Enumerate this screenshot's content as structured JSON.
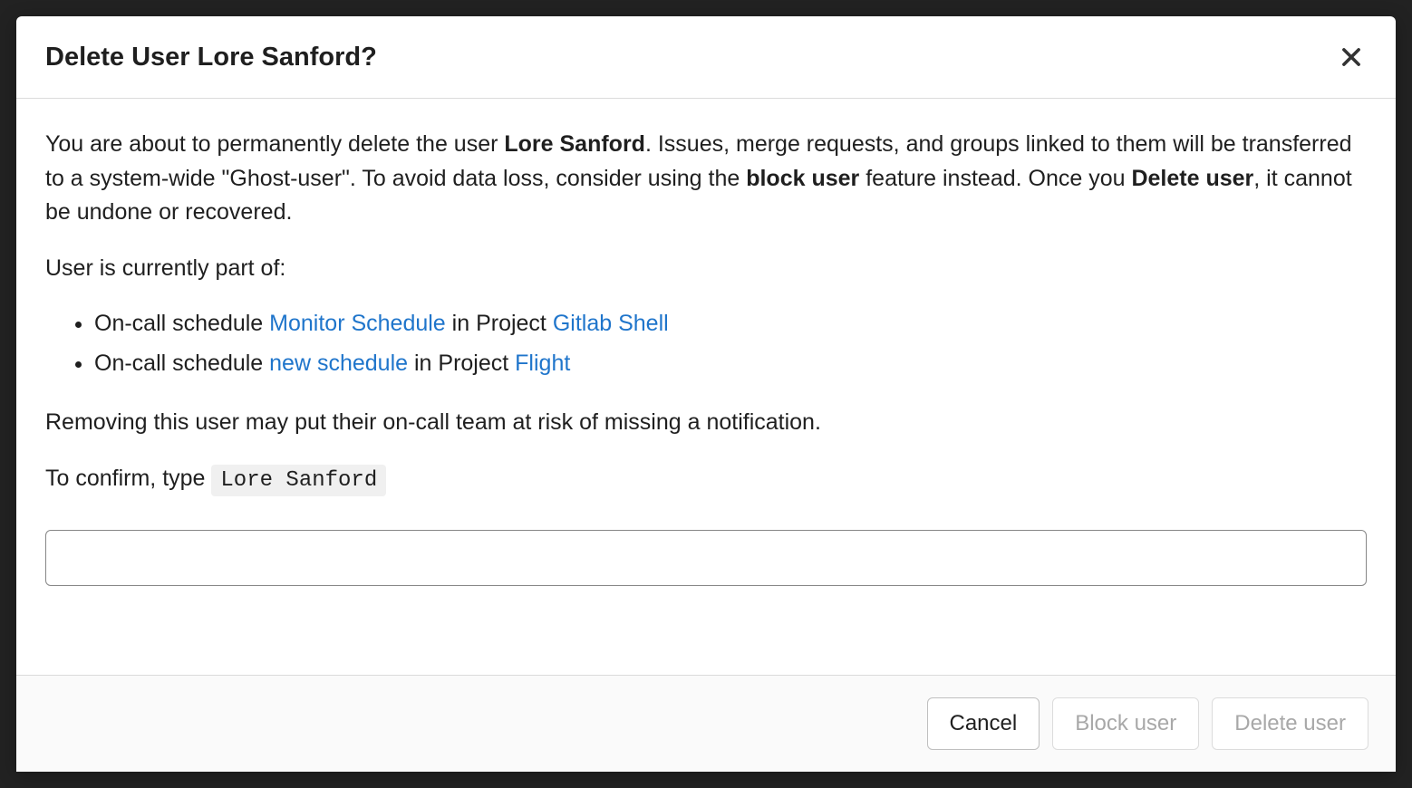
{
  "modal": {
    "title": "Delete User Lore Sanford?",
    "warning_intro": "You are about to permanently delete the user ",
    "warning_username": "Lore Sanford",
    "warning_ghost": ". Issues, merge requests, and groups linked to them will be transferred to a system-wide \"Ghost-user\". To avoid data loss, consider using the ",
    "warning_block_bold": "block user",
    "warning_instead": " feature instead. Once you ",
    "warning_delete_bold": "Delete user",
    "warning_tail": ", it cannot be undone or recovered.",
    "membership_intro": "User is currently part of:",
    "memberships": [
      {
        "prefix": "On-call schedule ",
        "schedule_link": "Monitor Schedule",
        "mid": " in Project ",
        "project_link": "Gitlab Shell"
      },
      {
        "prefix": "On-call schedule ",
        "schedule_link": "new schedule",
        "mid": " in Project ",
        "project_link": "Flight"
      }
    ],
    "risk_notice": "Removing this user may put their on-call team at risk of missing a notification.",
    "confirm_prefix": "To confirm, type ",
    "confirm_value": "Lore Sanford",
    "footer": {
      "cancel": "Cancel",
      "block": "Block user",
      "delete": "Delete user"
    }
  }
}
